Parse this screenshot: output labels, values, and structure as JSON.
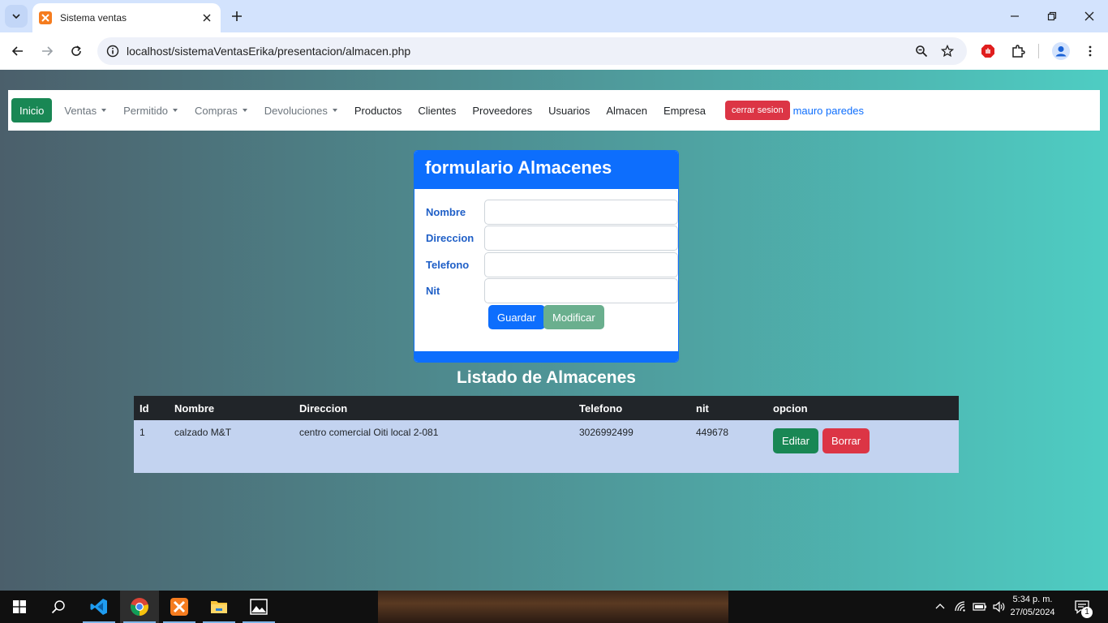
{
  "browser": {
    "tab_title": "Sistema ventas",
    "url": "localhost/sistemaVentasErika/presentacion/almacen.php"
  },
  "navbar": {
    "brand": "Inicio",
    "dropdowns": [
      "Ventas",
      "Permitido",
      "Compras",
      "Devoluciones"
    ],
    "links": [
      "Productos",
      "Clientes",
      "Proveedores",
      "Usuarios",
      "Almacen",
      "Empresa"
    ],
    "logout_label": "cerrar sesion",
    "user_name": "mauro paredes"
  },
  "form": {
    "title": "formulario Almacenes",
    "fields": [
      {
        "label": "Nombre",
        "value": ""
      },
      {
        "label": "Direccion",
        "value": ""
      },
      {
        "label": "Telefono",
        "value": ""
      },
      {
        "label": "Nit",
        "value": ""
      }
    ],
    "save_label": "Guardar",
    "modify_label": "Modificar"
  },
  "list": {
    "title": "Listado de Almacenes",
    "columns": [
      "Id",
      "Nombre",
      "Direccion",
      "Telefono",
      "nit",
      "opcion"
    ],
    "rows": [
      {
        "id": "1",
        "nombre": "calzado M&T",
        "direccion": "centro comercial Oiti local 2-081",
        "telefono": "3026992499",
        "nit": "449678",
        "edit_label": "Editar",
        "delete_label": "Borrar"
      }
    ]
  },
  "taskbar": {
    "time": "5:34 p. m.",
    "date": "27/05/2024",
    "notification_count": "1"
  },
  "colors": {
    "primary": "#0d6efd",
    "success": "#198754",
    "danger": "#dc3545",
    "table_header": "#212529",
    "table_row": "#c3d3f0"
  }
}
